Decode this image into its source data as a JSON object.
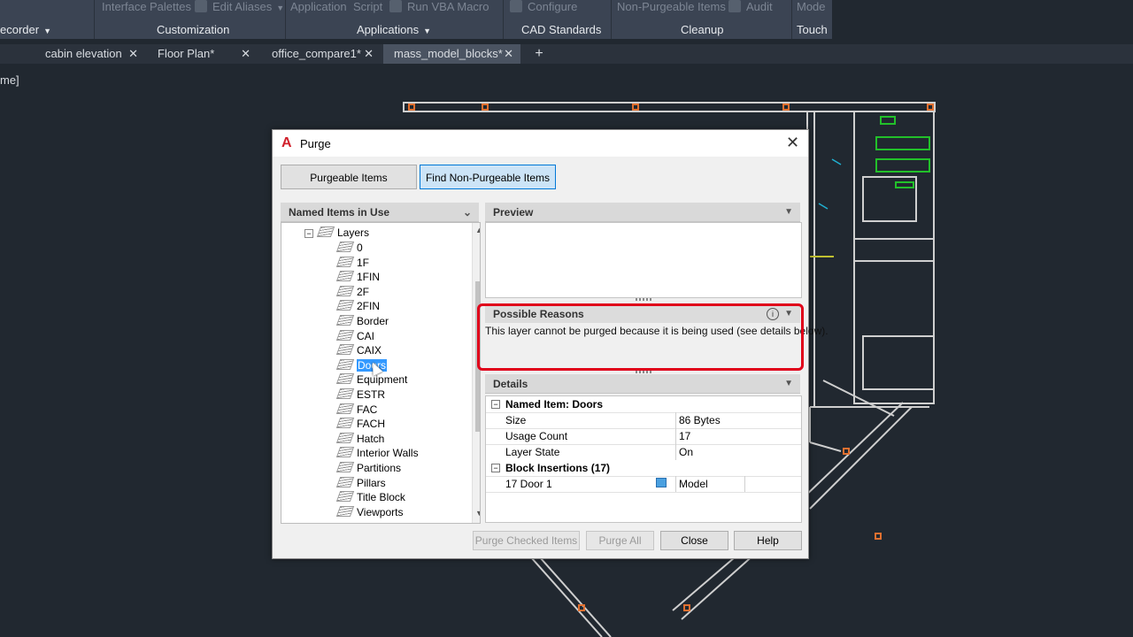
{
  "ribbon": {
    "row1": [
      "Interface",
      "Palettes",
      "Edit Aliases",
      "Application",
      "Script",
      "Run VBA Macro",
      "Configure",
      "Non-Purgeable Items",
      "Audit",
      "Mode"
    ],
    "panels": [
      "ecorder",
      "Customization",
      "Applications",
      "CAD Standards",
      "Cleanup",
      "Touch"
    ]
  },
  "tabs": [
    {
      "label": "cabin elevation",
      "active": false
    },
    {
      "label": "Floor Plan*",
      "active": false
    },
    {
      "label": "office_compare1*",
      "active": false
    },
    {
      "label": "mass_model_blocks*",
      "active": true
    }
  ],
  "tab_add": "+",
  "tab_close": "✕",
  "viewport_label": "me]",
  "dialog": {
    "title": "Purge",
    "close_glyph": "✕",
    "mode_buttons": [
      "Purgeable Items",
      "Find Non-Purgeable Items"
    ],
    "named_items_header": "Named Items in Use",
    "tree": {
      "root": "Layers",
      "items": [
        "0",
        "1F",
        "1FIN",
        "2F",
        "2FIN",
        "Border",
        "CAI",
        "CAIX",
        "Doors",
        "Equipment",
        "ESTR",
        "FAC",
        "FACH",
        "Hatch",
        "Interior Walls",
        "Partitions",
        "Pillars",
        "Title Block",
        "Viewports"
      ],
      "selected": "Doors"
    },
    "preview_header": "Preview",
    "reasons_header": "Possible Reasons",
    "reasons_text": "This layer cannot be purged because it is being used (see details below).",
    "details_header": "Details",
    "details": {
      "named_item": "Named Item: Doors",
      "size_label": "Size",
      "size_value": "86 Bytes",
      "usage_label": "Usage Count",
      "usage_value": "17",
      "state_label": "Layer State",
      "state_value": "On",
      "block_insertions": "Block Insertions (17)",
      "insertion_name": "17 Door 1",
      "insertion_space": "Model"
    },
    "buttons": {
      "purge_checked": "Purge Checked Items",
      "purge_all": "Purge All",
      "close": "Close",
      "help": "Help"
    }
  },
  "colors": {
    "background": "#212830",
    "ribbon": "#3b4453",
    "highlight_box": "#e0001a",
    "selection": "#3399ff"
  }
}
